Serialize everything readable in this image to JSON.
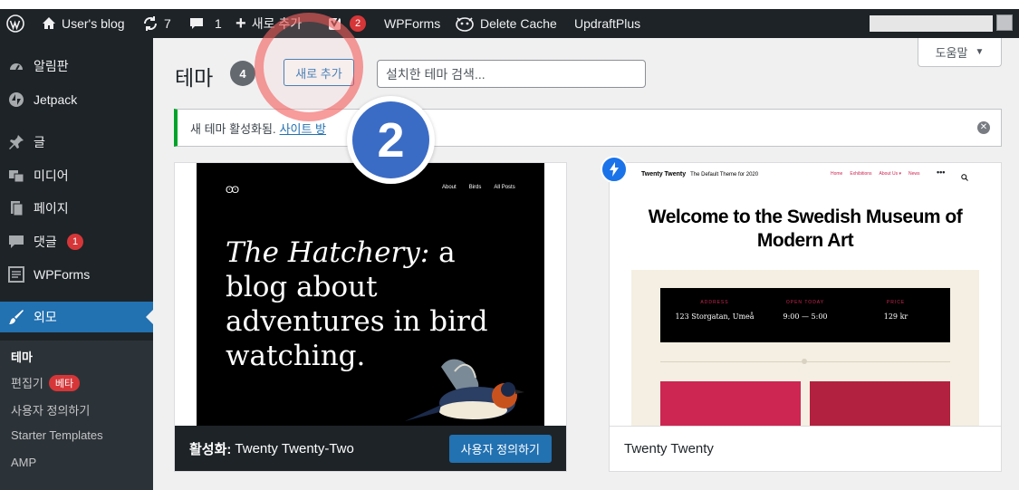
{
  "adminbar": {
    "site_name": "User's blog",
    "updates_count": "7",
    "comments_count": "1",
    "new_label": "새로 추가",
    "yoast_count": "2",
    "wpforms": "WPForms",
    "delete_cache": "Delete Cache",
    "updraft": "UpdraftPlus"
  },
  "sidebar": {
    "items": [
      {
        "label": "알림판",
        "icon": "dashboard-icon"
      },
      {
        "label": "Jetpack",
        "icon": "jetpack-icon"
      },
      {
        "label": "글",
        "icon": "pin-icon"
      },
      {
        "label": "미디어",
        "icon": "media-icon"
      },
      {
        "label": "페이지",
        "icon": "page-icon"
      },
      {
        "label": "댓글",
        "icon": "comment-icon",
        "badge": "1"
      },
      {
        "label": "WPForms",
        "icon": "wpforms-icon"
      },
      {
        "label": "외모",
        "icon": "brush-icon"
      }
    ],
    "submenu": {
      "themes": "테마",
      "editor": "편집기",
      "editor_badge": "베타",
      "customize": "사용자 정의하기",
      "starter": "Starter Templates",
      "amp": "AMP"
    }
  },
  "page": {
    "title": "테마",
    "count": "4",
    "add_new": "새로 추가",
    "search_placeholder": "설치한 테마 검색...",
    "help": "도움말",
    "notice_text": "새 테마 활성화됨.",
    "notice_link": "사이트 방"
  },
  "themes": [
    {
      "active_label": "활성화:",
      "name": "Twenty Twenty-Two",
      "action": "사용자 정의하기",
      "preview": {
        "logo": "ʘʘ",
        "nav": [
          "About",
          "Birds",
          "All Posts"
        ],
        "heading_italic": "The Hatchery:",
        "heading_rest": " a blog about adventures in bird watching."
      }
    },
    {
      "name": "Twenty Twenty",
      "preview": {
        "brand": "Twenty Twenty",
        "tagline": "The Default Theme for 2020",
        "nav": [
          "Home",
          "Exhibitions",
          "About Us ▾",
          "News"
        ],
        "title": "Welcome to the Swedish Museum of Modern Art",
        "cols": [
          {
            "label": "ADDRESS",
            "value": "123 Storgatan, Umeå"
          },
          {
            "label": "OPEN TODAY",
            "value": "9:00 — 5:00"
          },
          {
            "label": "PRICE",
            "value": "129 kr"
          }
        ]
      }
    }
  ],
  "overlay": {
    "step": "2"
  },
  "colors": {
    "adminbar": "#1d2327",
    "accent": "#2271b1",
    "notice_border": "#00a32a",
    "badge": "#d63638",
    "step": "#3b6cc5"
  }
}
